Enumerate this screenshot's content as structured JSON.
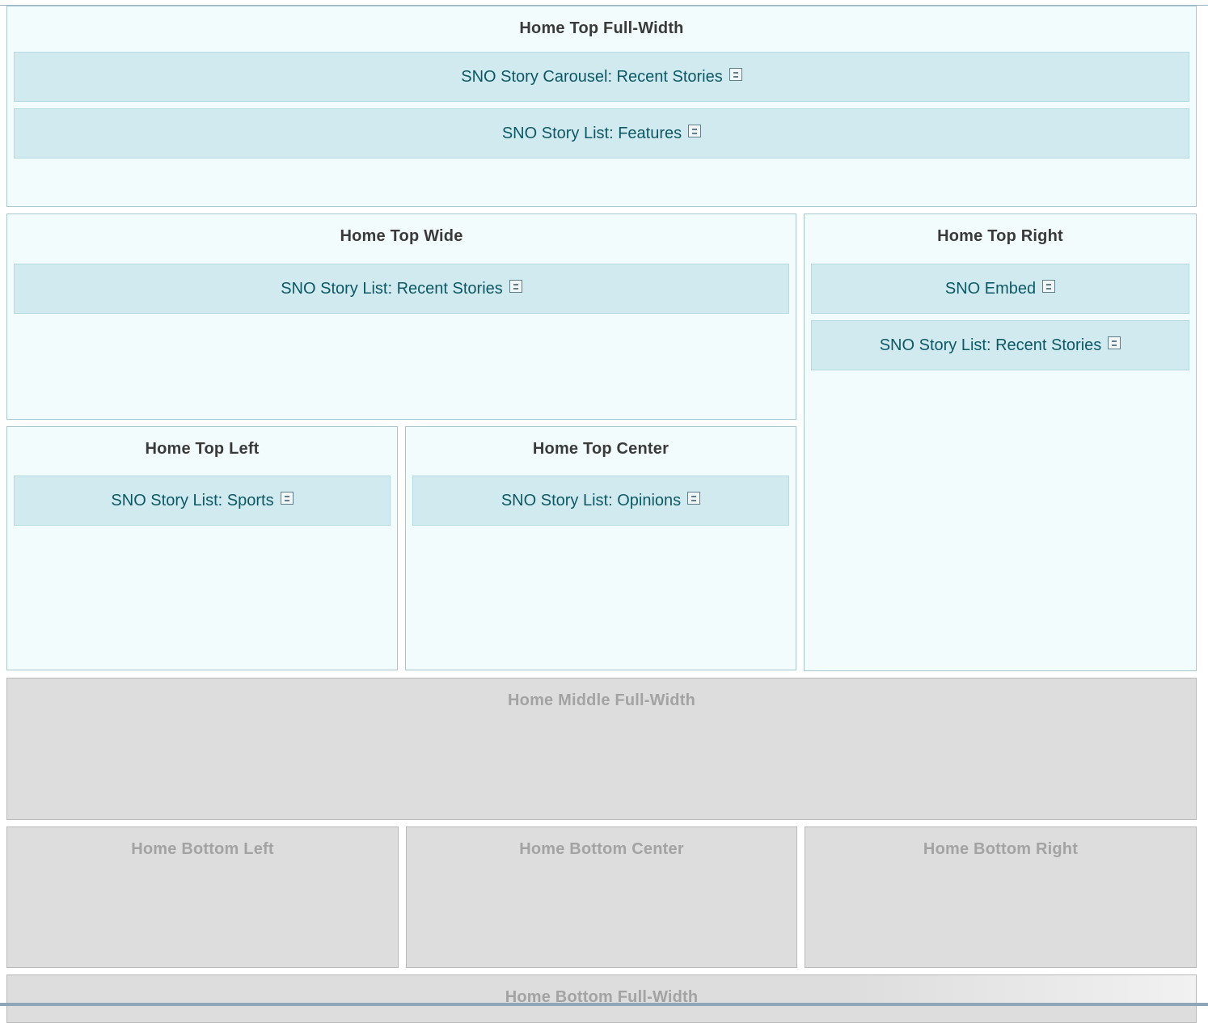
{
  "zones": {
    "home_top_full_width": {
      "title": "Home Top Full-Width",
      "widgets": [
        "SNO Story Carousel: Recent Stories",
        "SNO Story List: Features"
      ]
    },
    "home_top_wide": {
      "title": "Home Top Wide",
      "widgets": [
        "SNO Story List: Recent Stories"
      ]
    },
    "home_top_right": {
      "title": "Home Top Right",
      "widgets": [
        "SNO Embed",
        "SNO Story List: Recent Stories"
      ]
    },
    "home_top_left": {
      "title": "Home Top Left",
      "widgets": [
        "SNO Story List: Sports"
      ]
    },
    "home_top_center": {
      "title": "Home Top Center",
      "widgets": [
        "SNO Story List: Opinions"
      ]
    },
    "home_middle_full_width": {
      "title": "Home Middle Full-Width"
    },
    "home_bottom_left": {
      "title": "Home Bottom Left"
    },
    "home_bottom_center": {
      "title": "Home Bottom Center"
    },
    "home_bottom_right": {
      "title": "Home Bottom Right"
    },
    "home_bottom_full_width": {
      "title": "Home Bottom Full-Width"
    }
  },
  "icons": {
    "widget_icon": "widget-settings-icon"
  },
  "colors": {
    "active_zone_bg": "#f3fcfd",
    "widget_bg": "#d1eaf0",
    "widget_text": "#0c5965",
    "inactive_zone_bg": "#dddddd"
  }
}
